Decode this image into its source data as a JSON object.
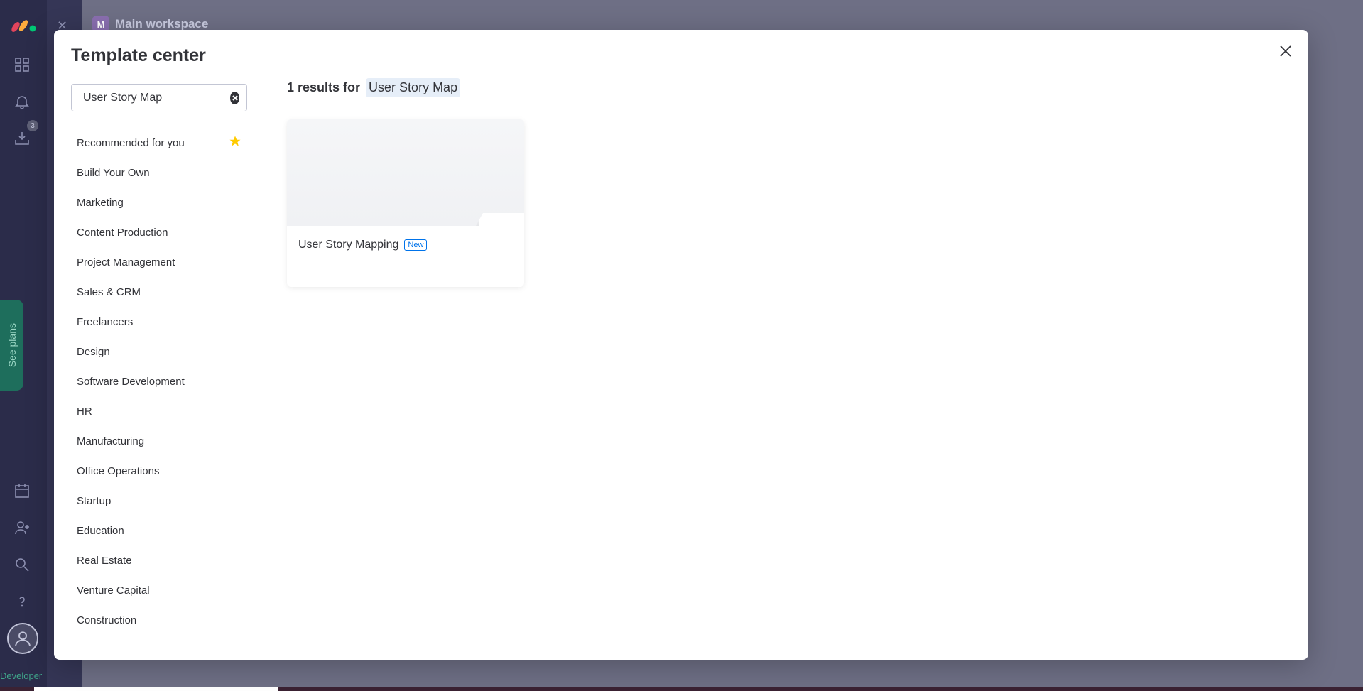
{
  "background": {
    "workspace_initial": "M",
    "workspace_name": "Main workspace",
    "notification_count": "3",
    "see_plans_label": "See plans",
    "developer_label": "Developer"
  },
  "modal": {
    "title": "Template center",
    "search": {
      "value": "User Story Map"
    },
    "categories": [
      {
        "label": "Recommended for you"
      },
      {
        "label": "Build Your Own"
      },
      {
        "label": "Marketing"
      },
      {
        "label": "Content Production"
      },
      {
        "label": "Project Management"
      },
      {
        "label": "Sales & CRM"
      },
      {
        "label": "Freelancers"
      },
      {
        "label": "Design"
      },
      {
        "label": "Software Development"
      },
      {
        "label": "HR"
      },
      {
        "label": "Manufacturing"
      },
      {
        "label": "Office Operations"
      },
      {
        "label": "Startup"
      },
      {
        "label": "Education"
      },
      {
        "label": "Real Estate"
      },
      {
        "label": "Venture Capital"
      },
      {
        "label": "Construction"
      }
    ],
    "results": {
      "count_text": "1 results for",
      "query": "User Story Map"
    },
    "cards": [
      {
        "title": "User Story Mapping",
        "badge": "New"
      }
    ]
  },
  "colors": {
    "accent": "#0073ea",
    "star": "#ffcb00",
    "text": "#323338"
  }
}
